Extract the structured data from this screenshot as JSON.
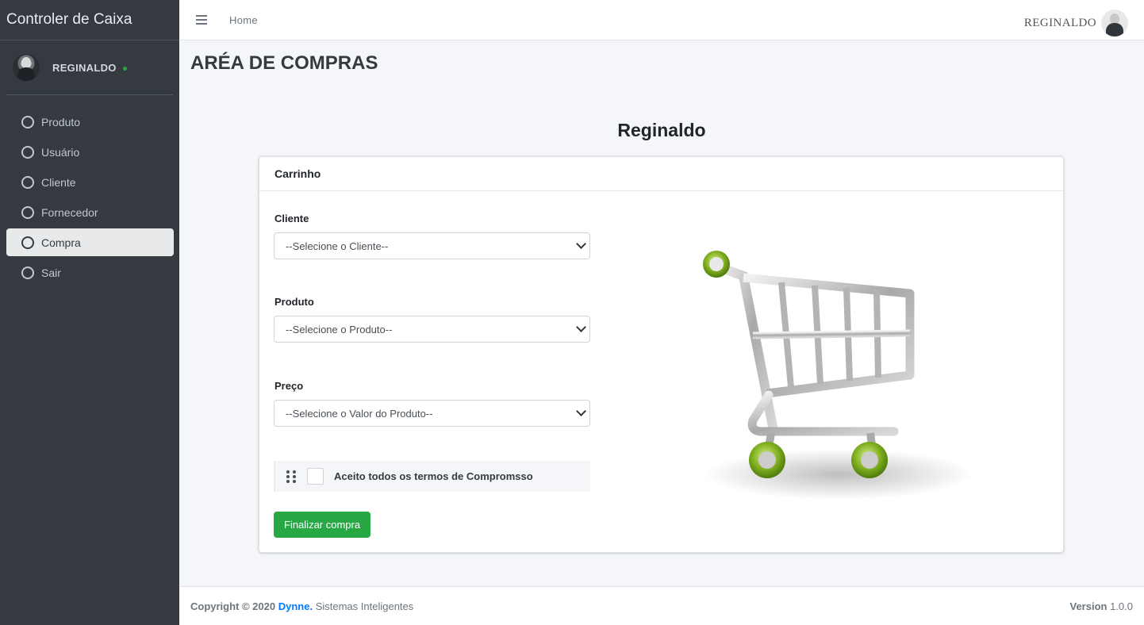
{
  "sidebar": {
    "brand": "Controler de Caixa",
    "user_name": "REGINALDO",
    "items": [
      {
        "label": "Produto"
      },
      {
        "label": "Usuário"
      },
      {
        "label": "Cliente"
      },
      {
        "label": "Fornecedor"
      },
      {
        "label": "Compra",
        "active": true
      },
      {
        "label": "Sair"
      }
    ]
  },
  "topbar": {
    "home_link": "Home",
    "user_name": "REGINALDO"
  },
  "page": {
    "title": "ARÉA DE COMPRAS",
    "customer_name": "Reginaldo"
  },
  "card": {
    "header": "Carrinho",
    "cliente": {
      "label": "Cliente",
      "selected": "--Selecione o Cliente--"
    },
    "produto": {
      "label": "Produto",
      "selected": "--Selecione o Produto--"
    },
    "preco": {
      "label": "Preço",
      "selected": "--Selecione o Valor do Produto--"
    },
    "terms_label": "Aceito todos os termos de Compromsso",
    "terms_checked": false,
    "finalize_button": "Finalizar compra",
    "cart_image_icon": "shopping-cart-icon"
  },
  "footer": {
    "copyright_prefix": "Copyright © 2020",
    "brand": "Dynne.",
    "suffix": "Sistemas Inteligentes",
    "version_label": "Version",
    "version": "1.0.0"
  },
  "colors": {
    "sidebar_bg": "#343a40",
    "success": "#28a745",
    "link": "#007bff"
  }
}
